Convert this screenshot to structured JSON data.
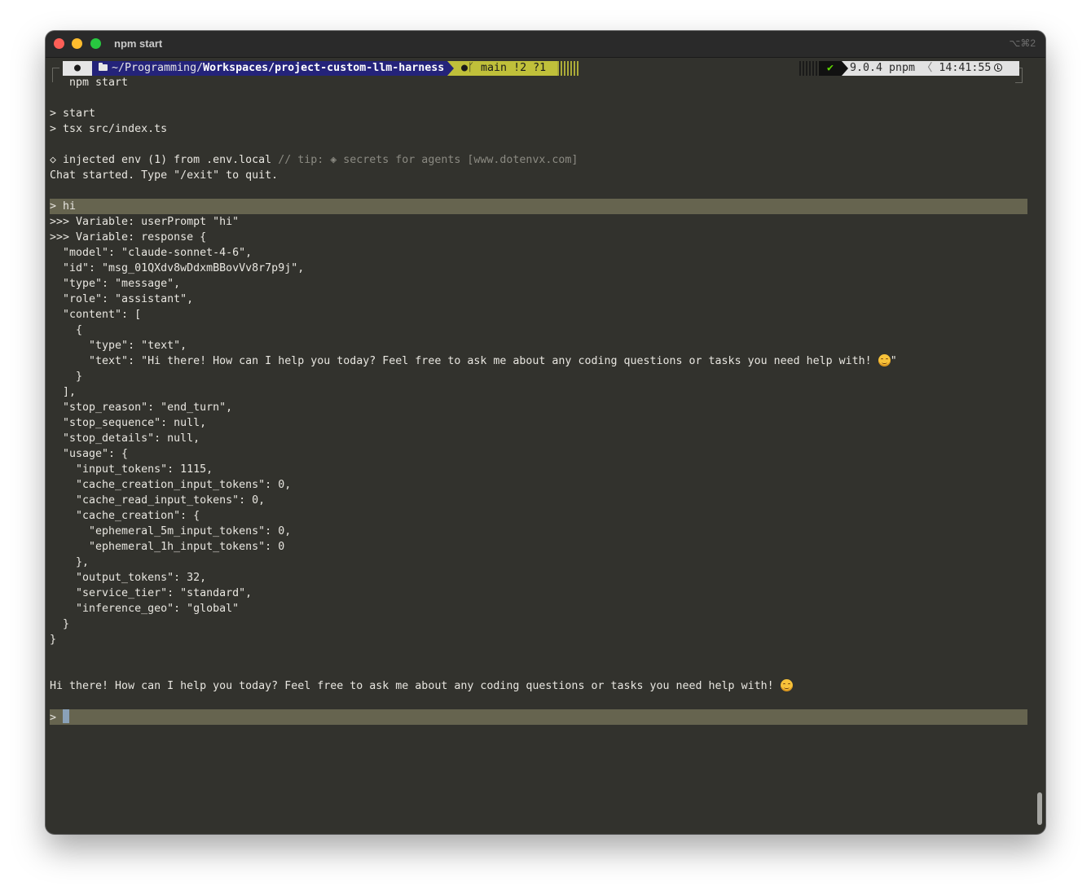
{
  "window": {
    "title": "npm start",
    "shortcut": "⌥⌘2"
  },
  "prompt_bar": {
    "os_icon": "apple-icon",
    "folder_icon": "folder-icon",
    "path_prefix": "~/Programming/",
    "path_bold": "Workspaces/project-custom-llm-harness",
    "git_icons": "🐙",
    "git_branch_glyph": "ᚴ",
    "git_branch": "main",
    "git_status": "!2 ?1",
    "ok_mark": "✔",
    "version": "9.0.4 pnpm",
    "separator": "〈",
    "time": "14:41:55",
    "clock_icon": "clock-icon"
  },
  "colors": {
    "background": "#32322d",
    "path_segment": "#24237a",
    "git_segment": "#c0c03a",
    "highlight_bar": "#66644f",
    "ok_check": "#5fd700"
  },
  "terminal": {
    "command": "npm start",
    "script_line1": "> start",
    "script_line2": "> tsx src/index.ts",
    "env_line": "◇ injected env (1) from .env.local",
    "env_tip": " // tip: ◈ secrets for agents [www.dotenvx.com]",
    "chat_started": "Chat started. Type \"/exit\" to quit.",
    "user_input": "> hi",
    "var_user_prompt": ">>> Variable: userPrompt \"hi\"",
    "var_response": ">>> Variable: response {",
    "json_lines": [
      "  \"model\": \"claude-sonnet-4-6\",",
      "  \"id\": \"msg_01QXdv8wDdxmBBovVv8r7p9j\",",
      "  \"type\": \"message\",",
      "  \"role\": \"assistant\",",
      "  \"content\": [",
      "    {",
      "      \"type\": \"text\",",
      "      \"text\": \"Hi there! How can I help you today? Feel free to ask me about any coding questions or tasks you need help with! ",
      "    }",
      "  ],",
      "  \"stop_reason\": \"end_turn\",",
      "  \"stop_sequence\": null,",
      "  \"stop_details\": null,",
      "  \"usage\": {",
      "    \"input_tokens\": 1115,",
      "    \"cache_creation_input_tokens\": 0,",
      "    \"cache_read_input_tokens\": 0,",
      "    \"cache_creation\": {",
      "      \"ephemeral_5m_input_tokens\": 0,",
      "      \"ephemeral_1h_input_tokens\": 0",
      "    },",
      "    \"output_tokens\": 32,",
      "    \"service_tier\": \"standard\",",
      "    \"inference_geo\": \"global\"",
      "  }",
      "}"
    ],
    "json_text_closing_quote": "\"",
    "assistant_reply": "Hi there! How can I help you today? Feel free to ask me about any coding questions or tasks you need help with! ",
    "emoji_name": "smiling-face-emoji",
    "input_prompt": "> "
  }
}
